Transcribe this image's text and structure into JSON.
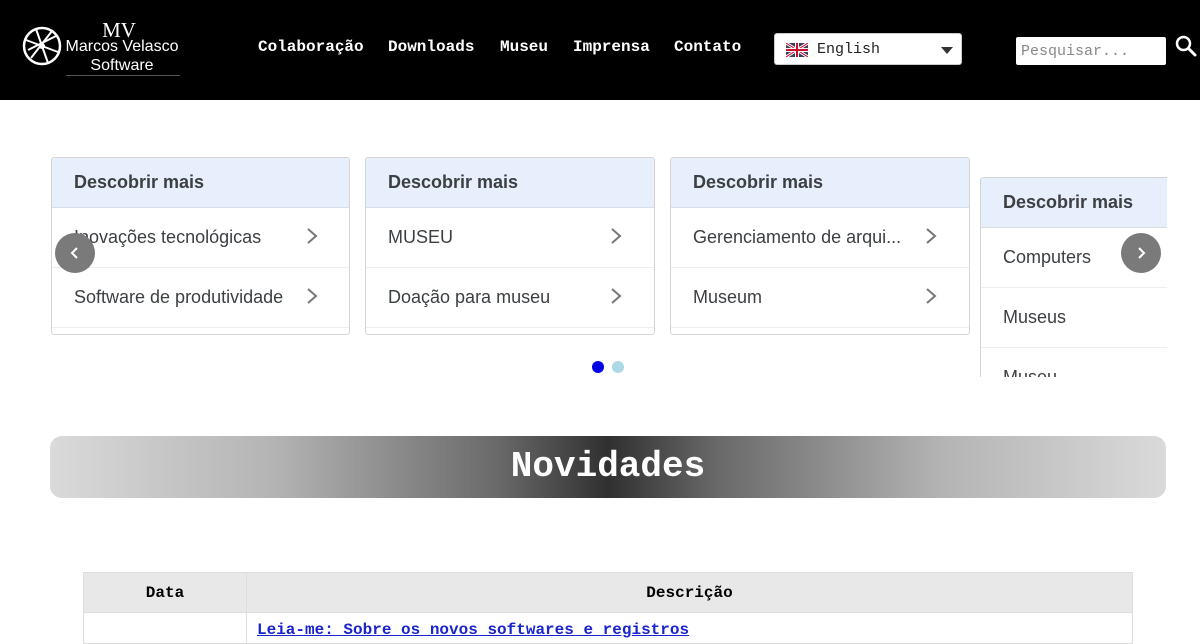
{
  "header": {
    "logo": {
      "mv": "MV",
      "line1": "Marcos Velasco",
      "line2": "Software"
    },
    "nav": [
      {
        "label": "Colaboração"
      },
      {
        "label": "Downloads"
      },
      {
        "label": "Museu"
      },
      {
        "label": "Imprensa"
      },
      {
        "label": "Contato"
      }
    ],
    "language": {
      "selected": "English",
      "flag_icon": "uk-flag-icon"
    },
    "search": {
      "placeholder": "Pesquisar...",
      "icon": "search-icon"
    }
  },
  "carousel": {
    "cards": [
      {
        "title": "Descobrir mais",
        "items": [
          "Inovações tecnológicas",
          "Software de produtividade"
        ]
      },
      {
        "title": "Descobrir mais",
        "items": [
          "MUSEU",
          "Doação para museu"
        ]
      },
      {
        "title": "Descobrir mais",
        "items": [
          "Gerenciamento de arqui...",
          "Museum"
        ]
      },
      {
        "title": "Descobrir mais",
        "items": [
          "Computers",
          "Museus",
          "Museu"
        ]
      }
    ],
    "dots": {
      "count": 2,
      "active_index": 0
    },
    "colors": {
      "dot_active": "#0000e6",
      "dot_inactive": "#add8e6",
      "card_header": "#e8effc"
    }
  },
  "news": {
    "title": "Novidades",
    "table": {
      "headers": [
        "Data",
        "Descrição"
      ],
      "rows": [
        {
          "date": "",
          "description": "Leia-me: Sobre os novos softwares e registros"
        }
      ]
    },
    "colors": {
      "link": "#1a24cc"
    }
  }
}
